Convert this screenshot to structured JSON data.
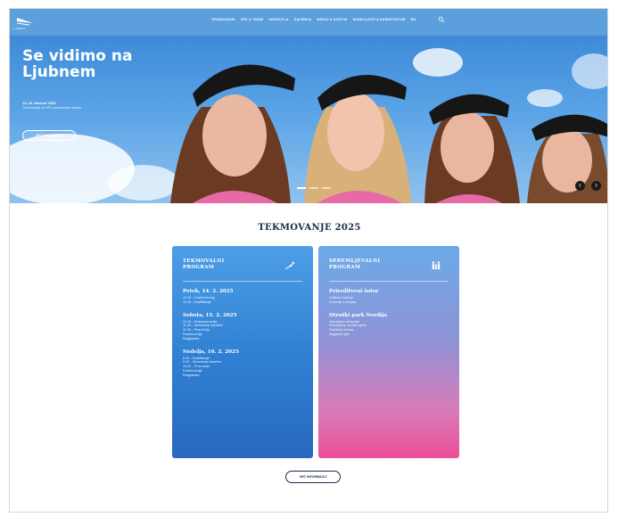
{
  "header": {
    "logo_text": "LJUBNO",
    "nav": [
      "Tekmovanje",
      "Več o tekmi",
      "Obvestila",
      "Galerija",
      "Mediji & gostje",
      "Sodelujoči & akreditacije",
      "EN"
    ],
    "search_icon": "search-icon"
  },
  "hero": {
    "title": "Se vidimo na Ljubnem",
    "date": "14.-16. februar 2025",
    "subtitle": "Tekmovanje za SP v smučarskih skokih",
    "button": "VEČ INFORMACIJ",
    "prev_icon": "chevron-left-icon",
    "next_icon": "chevron-right-icon"
  },
  "section": {
    "title": "TEKMOVANJE 2025"
  },
  "cards": {
    "left": {
      "title": "TEKMOVALNI PROGRAM",
      "icon": "ski-jumper-icon",
      "days": [
        {
          "title": "Petek, 14. 2. 2025",
          "lines": [
            "10.15 – Uradni trening",
            "12.15 – Kvalifikacije"
          ]
        },
        {
          "title": "Sobota, 15. 2. 2025",
          "lines": [
            "10.15 – Poskusna serija",
            "11.30 – Slovesnost otvoritve",
            "11.30 – Prva serija",
            "Finalna serija",
            "Razglasitev"
          ]
        },
        {
          "title": "Nedelja, 16. 2. 2025",
          "lines": [
            "8.30 – Kvalifikacije",
            "9.15 – Slovesnost otvoritve",
            "10.00 – Prva serija",
            "Finalna serija",
            "Razglasitev"
          ]
        }
      ]
    },
    "right": {
      "title": "SPREMLJEVALNI PROGRAM",
      "icon": "family-icon",
      "days": [
        {
          "title": "Prireditveni šotor",
          "lines": [
            "Glasbeni nastopi",
            "Druženje z navijači"
          ]
        },
        {
          "title": "Otroški park Nordija",
          "lines": [
            "Ustvarjalne delavnice",
            "Animacija in otroške igrice",
            "Poslikave obraza",
            "Nagradne igre"
          ]
        }
      ]
    }
  },
  "footer": {
    "button": "VEČ INFORMACIJ"
  }
}
